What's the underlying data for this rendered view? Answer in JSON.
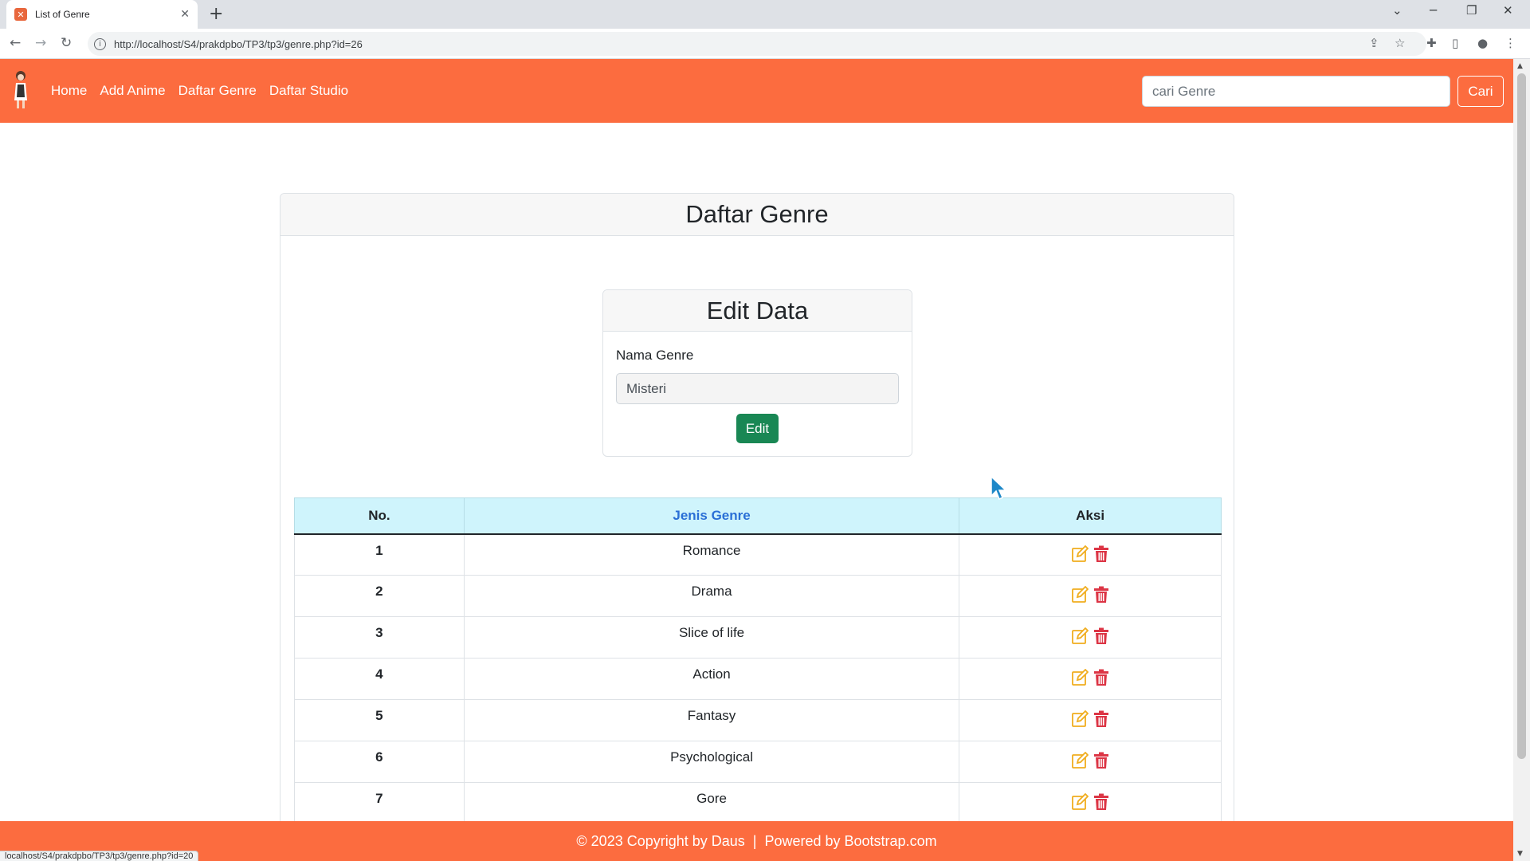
{
  "browser": {
    "tab_title": "List of Genre",
    "url": "http://localhost/S4/prakdpbo/TP3/tp3/genre.php?id=26",
    "status_url": "localhost/S4/prakdpbo/TP3/tp3/genre.php?id=20"
  },
  "navbar": {
    "links": [
      "Home",
      "Add Anime",
      "Daftar Genre",
      "Daftar Studio"
    ],
    "search_placeholder": "cari Genre",
    "search_button": "Cari"
  },
  "page": {
    "title": "Daftar Genre"
  },
  "edit_form": {
    "title": "Edit Data",
    "label": "Nama Genre",
    "value": "Misteri",
    "button": "Edit"
  },
  "table": {
    "headers": [
      "No.",
      "Jenis Genre",
      "Aksi"
    ],
    "rows": [
      {
        "no": "1",
        "genre": "Romance"
      },
      {
        "no": "2",
        "genre": "Drama"
      },
      {
        "no": "3",
        "genre": "Slice of life"
      },
      {
        "no": "4",
        "genre": "Action"
      },
      {
        "no": "5",
        "genre": "Fantasy"
      },
      {
        "no": "6",
        "genre": "Psychological"
      },
      {
        "no": "7",
        "genre": "Gore"
      }
    ]
  },
  "footer": {
    "text": "© 2023 Copyright by Daus  |  Powered by Bootstrap.com"
  },
  "colors": {
    "brand": "#fc6c3f",
    "edit_button": "#198754",
    "table_header_bg": "#cff4fc",
    "edit_icon": "#f0ad1f",
    "delete_icon": "#dc3545"
  }
}
